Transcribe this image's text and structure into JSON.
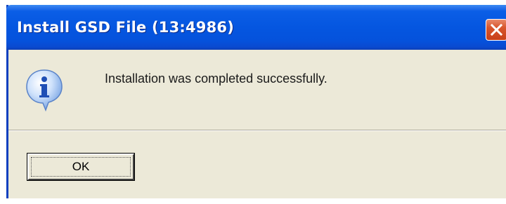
{
  "dialog": {
    "title": "Install GSD File (13:4986)",
    "message": "Installation was completed successfully.",
    "icon": "info-icon",
    "ok_label": "OK"
  },
  "colors": {
    "titlebar": "#0556e0",
    "close_button": "#d8552c",
    "dialog_background": "#ece9d8"
  }
}
